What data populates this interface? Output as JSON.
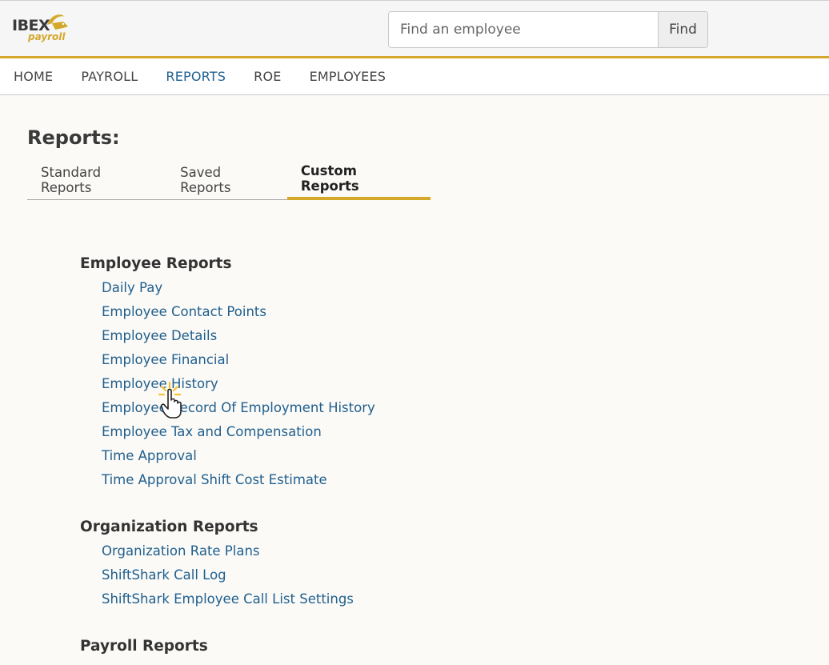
{
  "header": {
    "logo_text": "IBEX",
    "logo_sub": "payroll",
    "search_placeholder": "Find an employee",
    "search_button": "Find"
  },
  "nav": {
    "items": [
      "HOME",
      "PAYROLL",
      "REPORTS",
      "ROE",
      "EMPLOYEES"
    ],
    "active": "REPORTS"
  },
  "page": {
    "title": "Reports:",
    "tabs": [
      "Standard Reports",
      "Saved Reports",
      "Custom Reports"
    ],
    "active_tab": "Custom Reports"
  },
  "sections": [
    {
      "title": "Employee Reports",
      "items": [
        "Daily Pay",
        "Employee Contact Points",
        "Employee Details",
        "Employee Financial",
        "Employee History",
        "Employee Record Of Employment History",
        "Employee Tax and Compensation",
        "Time Approval",
        "Time Approval Shift Cost Estimate"
      ]
    },
    {
      "title": "Organization Reports",
      "items": [
        "Organization Rate Plans",
        "ShiftShark Call Log",
        "ShiftShark Employee Call List Settings"
      ]
    },
    {
      "title": "Payroll Reports",
      "items": []
    }
  ],
  "colors": {
    "accent": "#d4a82a",
    "link": "#1f5f8f",
    "background": "#fbfaf6"
  },
  "icons": {
    "cursor": "hand-pointer-click-icon",
    "logo": "ibex-goat-icon"
  }
}
